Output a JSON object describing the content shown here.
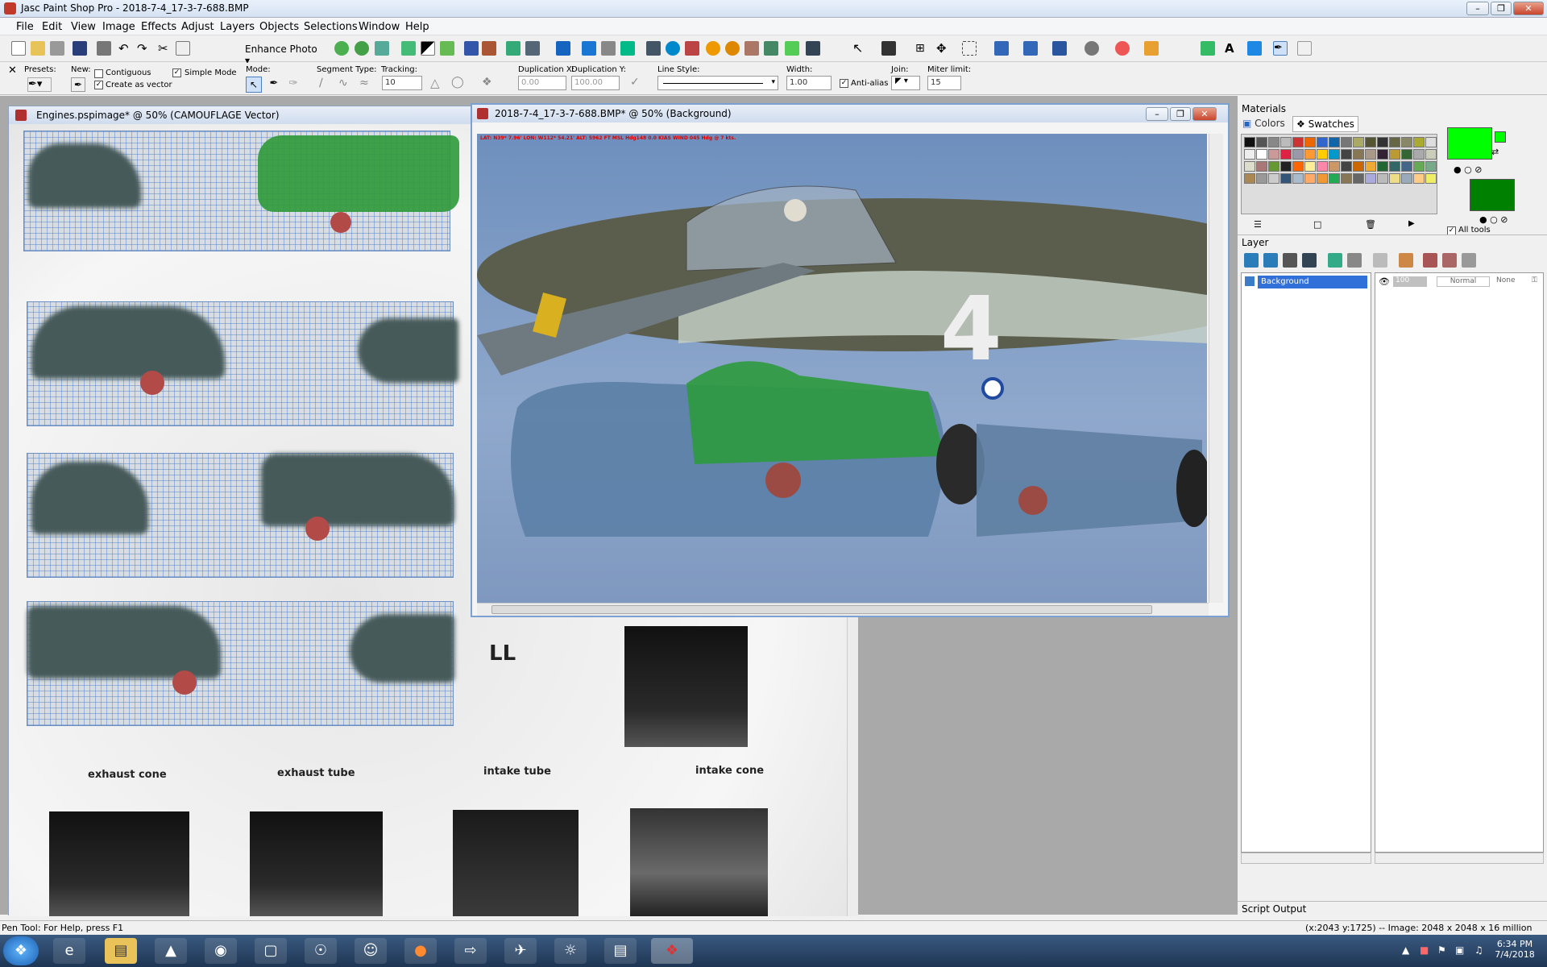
{
  "window": {
    "title": "Jasc Paint Shop Pro - 2018-7-4_17-3-7-688.BMP"
  },
  "menu": [
    "File",
    "Edit",
    "View",
    "Image",
    "Effects",
    "Adjust",
    "Layers",
    "Objects",
    "Selections",
    "Window",
    "Help"
  ],
  "toolbar": {
    "enhance_label": "Enhance Photo"
  },
  "options": {
    "presets_label": "Presets:",
    "new_label": "New:",
    "contiguous_label": "Contiguous",
    "create_vector_label": "Create as vector",
    "simple_mode_label": "Simple Mode",
    "mode_label": "Mode:",
    "segment_label": "Segment Type:",
    "tracking_label": "Tracking:",
    "tracking_value": "10",
    "dupx_label": "Duplication X:",
    "dupx_value": "0.00",
    "dupy_label": "Duplication Y:",
    "dupy_value": "100.00",
    "linestyle_label": "Line Style:",
    "width_label": "Width:",
    "width_value": "1.00",
    "antialias_label": "Anti-alias",
    "join_label": "Join:",
    "miter_label": "Miter limit:",
    "miter_value": "15"
  },
  "doc_engines": {
    "title": "Engines.pspimage* @  50% (CAMOUFLAGE Vector)",
    "ll_label": "LL",
    "labels": [
      "exhaust cone",
      "exhaust tube",
      "intake tube",
      "intake cone"
    ]
  },
  "doc_bmp": {
    "title": "2018-7-4_17-3-7-688.BMP* @  50% (Background)",
    "hud": "LAT: N39* 7.96'  LON: W112* 54.21'  ALT: 5962 FT  MSL  Hdg148  0.0 KIAS  WIND 045 Hdg @ 7 kts."
  },
  "materials": {
    "title": "Materials",
    "tab_colors": "Colors",
    "tab_swatches": "Swatches",
    "all_tools_label": "All tools",
    "fg_color": "#00ff00",
    "bg_color": "#008000"
  },
  "layer_panel": {
    "title": "Layer",
    "layer_name": "Background",
    "opacity": "100",
    "blend": "Normal",
    "mask": "None"
  },
  "script_output": {
    "title": "Script Output"
  },
  "status": {
    "help": "Pen Tool: For Help, press F1",
    "info": "(x:2043 y:1725) -- Image:  2048 x 2048 x 16 million"
  },
  "clock": {
    "time": "6:34 PM",
    "date": "7/4/2018"
  }
}
